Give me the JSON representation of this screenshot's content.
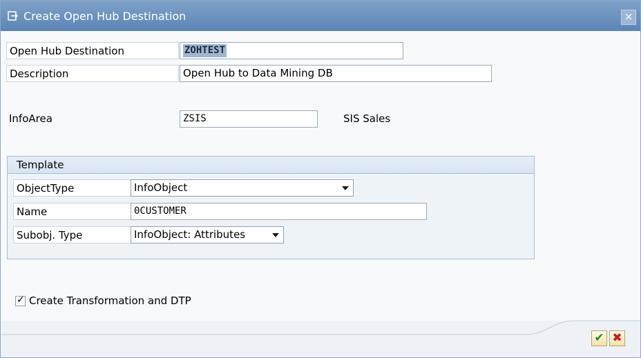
{
  "window": {
    "title": "Create Open Hub Destination",
    "close_symbol": "×"
  },
  "form": {
    "destination": {
      "label": "Open Hub Destination",
      "value": "ZOHTEST"
    },
    "description": {
      "label": "Description",
      "value": "Open Hub to Data Mining DB"
    },
    "infoarea": {
      "label": "InfoArea",
      "value": "ZSIS",
      "text": "SIS Sales"
    }
  },
  "template": {
    "title": "Template",
    "object_type": {
      "label": "ObjectType",
      "value": "InfoObject"
    },
    "name": {
      "label": "Name",
      "value": "0CUSTOMER"
    },
    "subobj_type": {
      "label": "Subobj. Type",
      "value": "InfoObject: Attributes"
    }
  },
  "options": {
    "create_transformation": {
      "label": "Create Transformation and DTP",
      "checked": true,
      "mark": "✓"
    }
  },
  "buttons": {
    "ok": "✔",
    "cancel": "✖"
  },
  "icons": {
    "title": "dialog-icon",
    "ok": "check-icon",
    "cancel": "cancel-icon"
  }
}
